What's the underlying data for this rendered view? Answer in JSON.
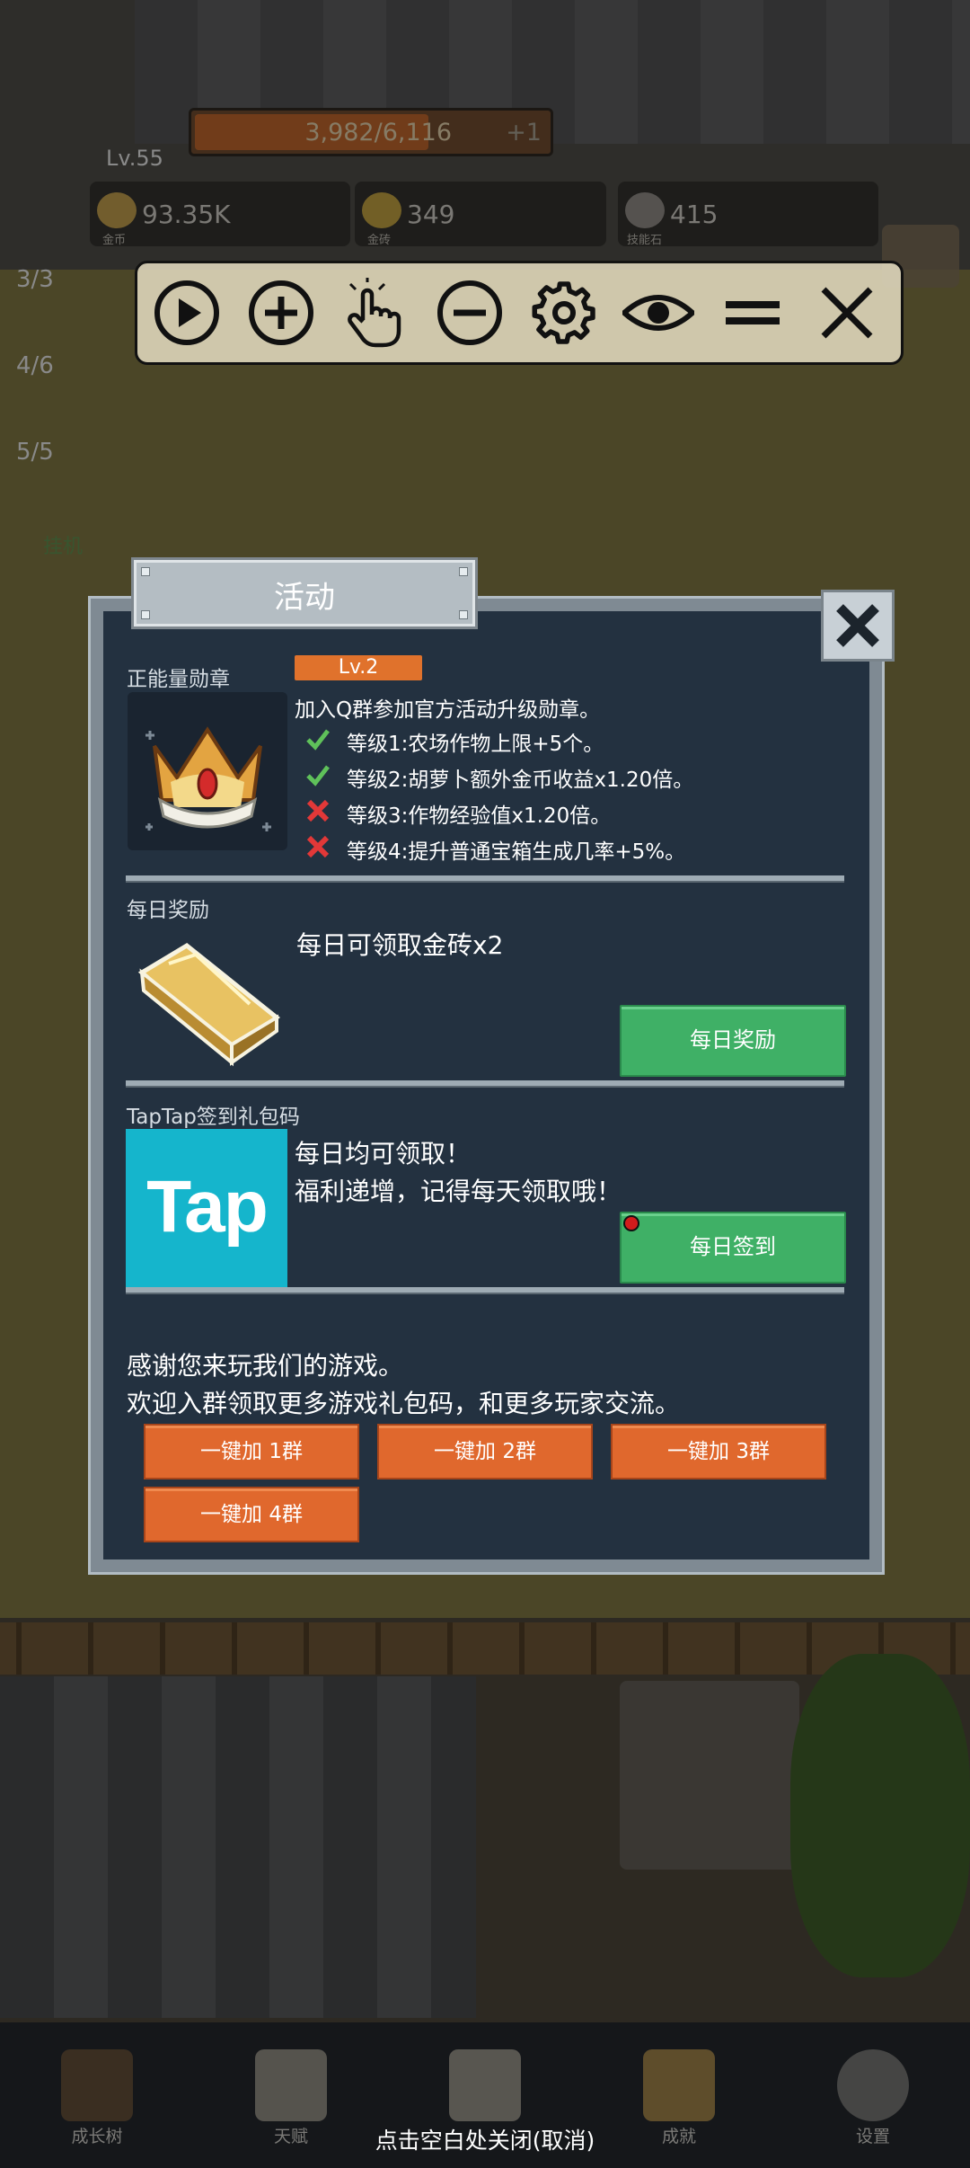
{
  "hud": {
    "level": "Lv.55",
    "exp_text": "3,982/6,116",
    "exp_fraction": 0.651,
    "exp_bonus": "+1",
    "resources": [
      {
        "value": "93.35K",
        "caption": "金币",
        "icon": "coin-icon"
      },
      {
        "value": "349",
        "caption": "金砖",
        "icon": "gold-brick-icon"
      },
      {
        "value": "415",
        "caption": "技能石",
        "icon": "skill-stone-icon"
      }
    ],
    "left_counters": [
      "3/3",
      "4/6",
      "5/5"
    ],
    "left_afk": "挂机"
  },
  "toolbar": {
    "buttons": [
      "play-icon",
      "zoom-in-icon",
      "tap-icon",
      "zoom-out-icon",
      "gear-icon",
      "eye-icon",
      "menu-icon",
      "close-icon"
    ]
  },
  "panel": {
    "title": "活动",
    "medal": {
      "label": "正能量勋章",
      "level": "Lv.2",
      "description": "加入Q群参加官方活动升级勋章。",
      "levels": [
        {
          "text": "等级1:农场作物上限+5个。",
          "unlocked": true
        },
        {
          "text": "等级2:胡萝卜额外金币收益x1.20倍。",
          "unlocked": true
        },
        {
          "text": "等级3:作物经验值x1.20倍。",
          "unlocked": false
        },
        {
          "text": "等级4:提升普通宝箱生成几率+5%。",
          "unlocked": false
        }
      ]
    },
    "daily": {
      "label": "每日奖励",
      "text": "每日可领取金砖x2",
      "button": "每日奖励"
    },
    "taptap": {
      "label": "TapTap签到礼包码",
      "logo_text": "Tap",
      "line1": "每日均可领取！",
      "line2": "福利递增，记得每天领取哦！",
      "button": "每日签到"
    },
    "thanks": {
      "line1": "感谢您来玩我们的游戏。",
      "line2": "欢迎入群领取更多游戏礼包码，和更多玩家交流。"
    },
    "group_buttons": [
      "一键加 1群",
      "一键加 2群",
      "一键加 3群",
      "一键加 4群"
    ]
  },
  "bottom_nav": {
    "items": [
      "成长树",
      "天赋",
      "",
      "成就",
      "设置"
    ],
    "close_hint": "点击空白处关闭(取消)"
  },
  "colors": {
    "panel_bg": "#233140",
    "green_button": "#3fb066",
    "orange_button": "#e0682d",
    "level_tag": "#e0722c"
  }
}
